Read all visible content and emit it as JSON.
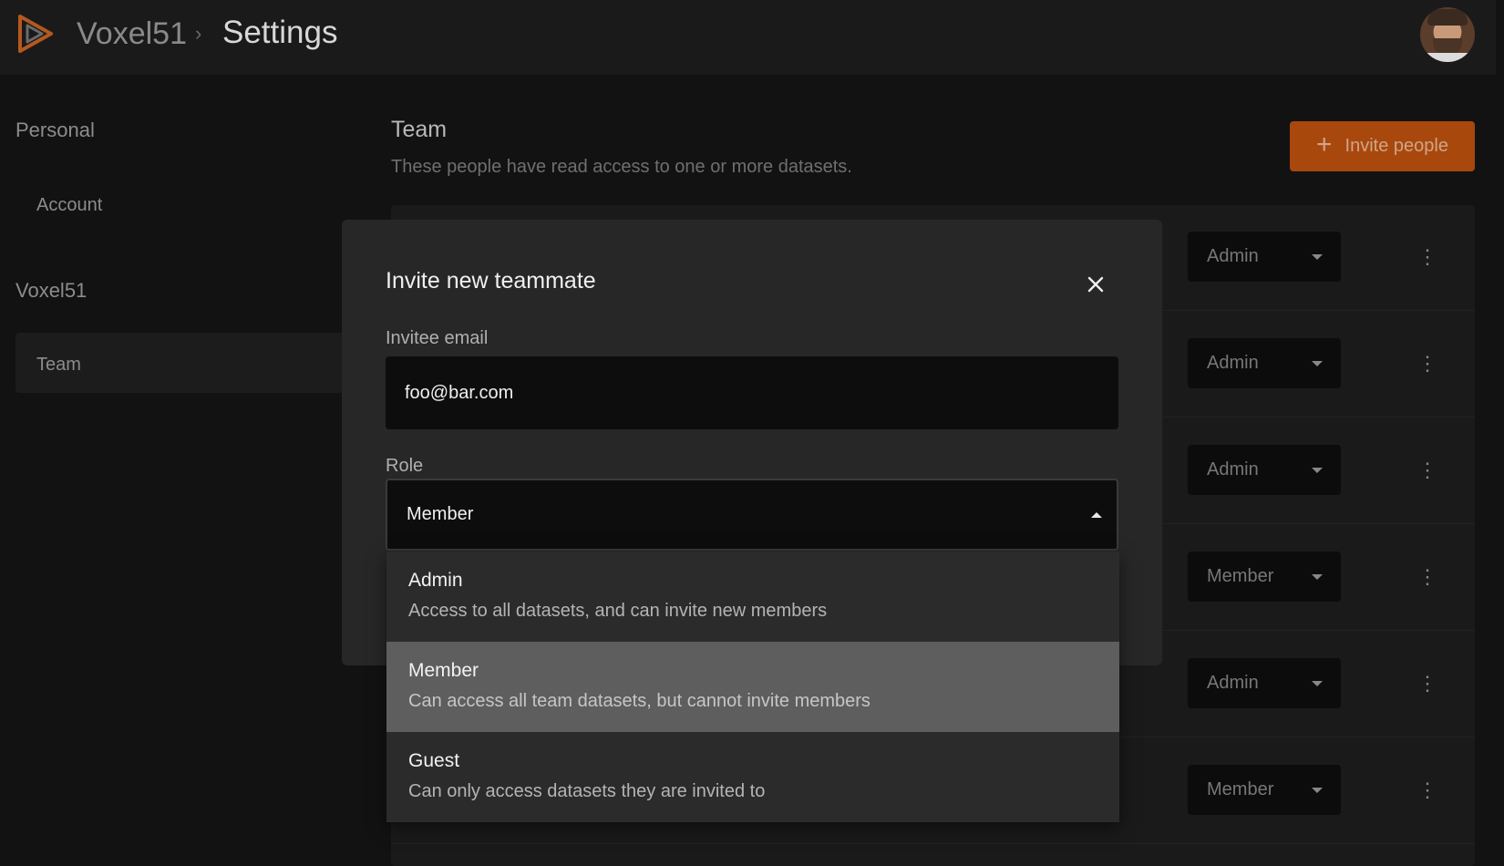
{
  "header": {
    "org": "Voxel51",
    "separator": "›",
    "page": "Settings"
  },
  "sidebar": {
    "sections": [
      {
        "heading": "Personal",
        "items": [
          {
            "label": "Account",
            "active": false
          }
        ]
      },
      {
        "heading": "Voxel51",
        "items": [
          {
            "label": "Team",
            "active": true
          }
        ]
      }
    ]
  },
  "main": {
    "title": "Team",
    "subtitle": "These people have read access to one or more datasets.",
    "invite_button": {
      "icon": "plus-icon",
      "label": "Invite people"
    },
    "rows": [
      {
        "role": "Admin"
      },
      {
        "role": "Admin"
      },
      {
        "role": "Admin"
      },
      {
        "role": "Member"
      },
      {
        "role": "Admin"
      },
      {
        "role": "Member"
      }
    ]
  },
  "modal": {
    "title": "Invite new teammate",
    "close_icon": "close-icon",
    "email": {
      "label": "Invitee email",
      "value": "foo@bar.com"
    },
    "role": {
      "label": "Role",
      "value": "Member",
      "options": [
        {
          "name": "Admin",
          "description": "Access to all datasets, and can invite new members",
          "selected": false
        },
        {
          "name": "Member",
          "description": "Can access all team datasets, but cannot invite members",
          "selected": true
        },
        {
          "name": "Guest",
          "description": "Can only access datasets they are invited to",
          "selected": false
        }
      ]
    }
  },
  "colors": {
    "accent": "#a8480d",
    "background": "#121212",
    "modal": "#272727"
  }
}
